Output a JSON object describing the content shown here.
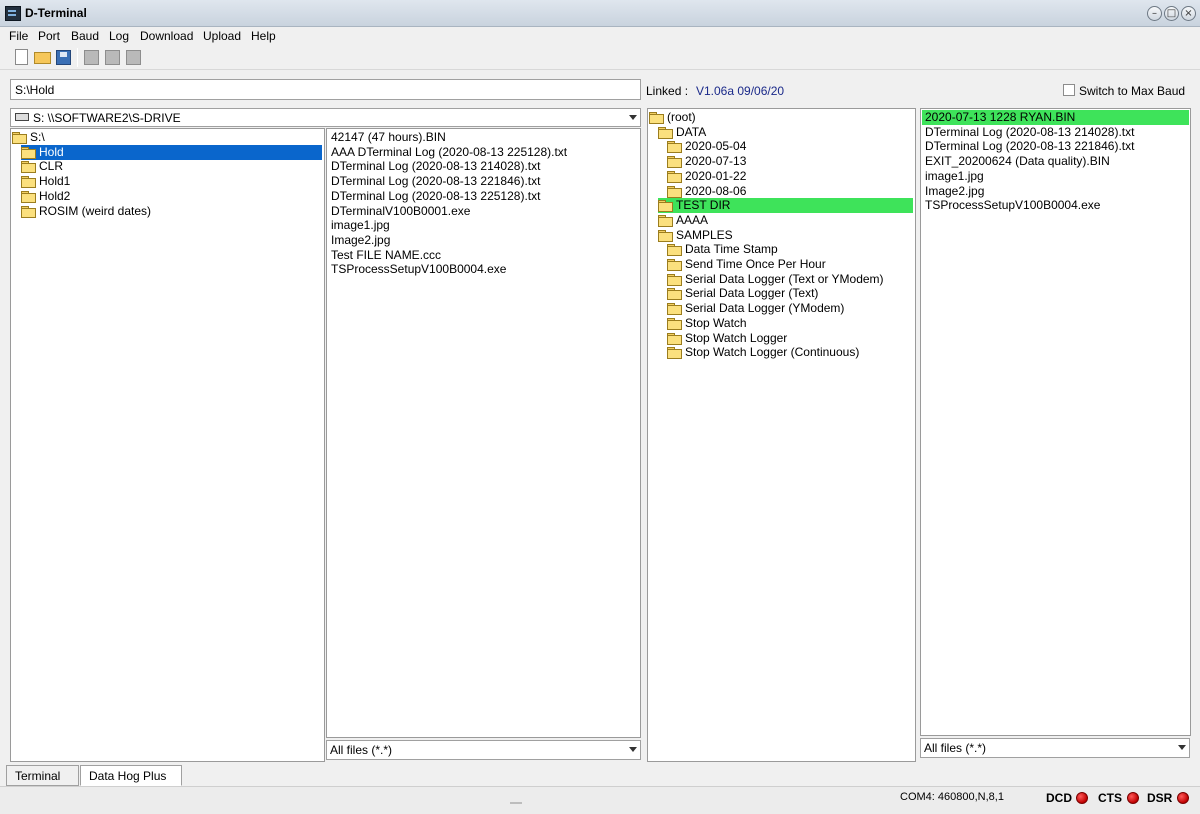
{
  "window": {
    "title": "D-Terminal",
    "buttons": [
      "–",
      "□",
      "×"
    ]
  },
  "menu": [
    "File",
    "Port",
    "Baud",
    "Log",
    "Download",
    "Upload",
    "Help"
  ],
  "toolbar": {
    "icons": [
      "new-file-icon",
      "open-folder-icon",
      "save-icon",
      "add-icon",
      "copy-icon",
      "paste-icon"
    ]
  },
  "path_bar": {
    "path": "S:\\Hold",
    "linked_label": "Linked :",
    "linked_value": "V1.06a 09/06/20",
    "max_baud_label": "Switch to Max Baud",
    "max_baud_checked": false
  },
  "left": {
    "drive": "S: \\\\SOFTWARE2\\S-DRIVE",
    "tree": [
      {
        "label": "S:\\",
        "level": 0,
        "open": true
      },
      {
        "label": "Hold",
        "level": 1,
        "open": true,
        "selected": true
      },
      {
        "label": "CLR",
        "level": 1
      },
      {
        "label": "Hold1",
        "level": 1
      },
      {
        "label": "Hold2",
        "level": 1
      },
      {
        "label": "ROSIM (weird dates)",
        "level": 1
      }
    ],
    "files": [
      "42147 (47 hours).BIN",
      "AAA DTerminal Log (2020-08-13 225128).txt",
      "DTerminal Log (2020-08-13 214028).txt",
      "DTerminal Log (2020-08-13 221846).txt",
      "DTerminal Log (2020-08-13 225128).txt",
      "DTerminalV100B0001.exe",
      "image1.jpg",
      "Image2.jpg",
      "Test FILE NAME.ccc",
      "TSProcessSetupV100B0004.exe"
    ],
    "filter": "All files (*.*)"
  },
  "right": {
    "tree": [
      {
        "label": "(root)",
        "level": 0,
        "open": true
      },
      {
        "label": "DATA",
        "level": 1,
        "open": true
      },
      {
        "label": "2020-05-04",
        "level": 2
      },
      {
        "label": "2020-07-13",
        "level": 2
      },
      {
        "label": "2020-01-22",
        "level": 2
      },
      {
        "label": "2020-08-06",
        "level": 2
      },
      {
        "label": "TEST DIR",
        "level": 1,
        "open": true,
        "selected": true
      },
      {
        "label": "AAAA",
        "level": 1,
        "open": true
      },
      {
        "label": "SAMPLES",
        "level": 1,
        "open": true
      },
      {
        "label": "Data Time Stamp",
        "level": 2
      },
      {
        "label": "Send Time Once Per Hour",
        "level": 2
      },
      {
        "label": "Serial Data Logger (Text or YModem)",
        "level": 2
      },
      {
        "label": "Serial Data Logger (Text)",
        "level": 2
      },
      {
        "label": "Serial Data Logger (YModem)",
        "level": 2
      },
      {
        "label": "Stop Watch",
        "level": 2
      },
      {
        "label": "Stop Watch Logger",
        "level": 2
      },
      {
        "label": "Stop Watch Logger (Continuous)",
        "level": 2
      }
    ],
    "files": [
      {
        "label": "2020-07-13 1228 RYAN.BIN",
        "selected": true
      },
      {
        "label": "DTerminal Log (2020-08-13 214028).txt"
      },
      {
        "label": "DTerminal Log (2020-08-13 221846).txt"
      },
      {
        "label": "EXIT_20200624 (Data quality).BIN"
      },
      {
        "label": "image1.jpg"
      },
      {
        "label": "Image2.jpg"
      },
      {
        "label": "TSProcessSetupV100B0004.exe"
      }
    ],
    "filter": "All files (*.*)"
  },
  "tabs": [
    "Terminal",
    "Data Hog Plus"
  ],
  "status": {
    "port": "COM4: 460800,N,8,1",
    "signals": [
      {
        "name": "DCD",
        "color": "#d00000"
      },
      {
        "name": "CTS",
        "color": "#d00000"
      },
      {
        "name": "DSR",
        "color": "#d00000"
      }
    ]
  },
  "colors": {
    "select_blue": "#0a66cc",
    "select_green": "#3ee35a",
    "linked_text": "#1b2a8a"
  }
}
